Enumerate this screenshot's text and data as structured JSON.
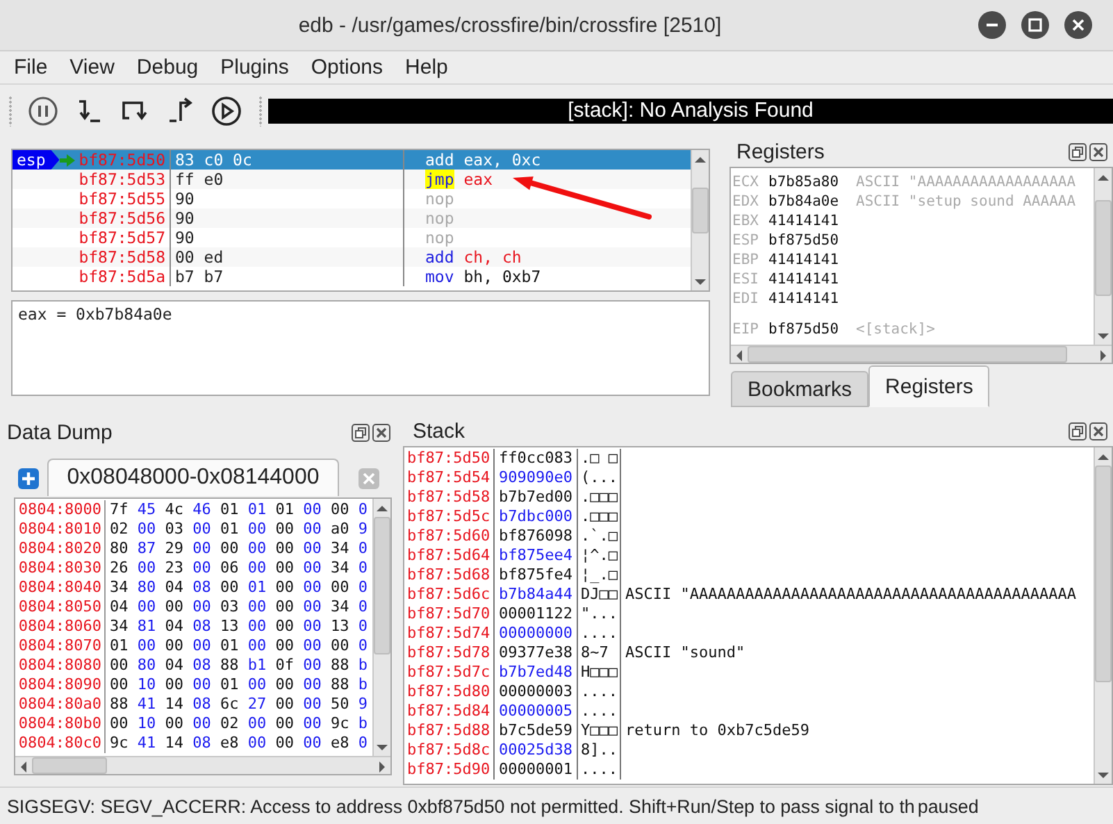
{
  "window": {
    "title": "edb - /usr/games/crossfire/bin/crossfire [2510]"
  },
  "menu": [
    "File",
    "View",
    "Debug",
    "Plugins",
    "Options",
    "Help"
  ],
  "toolbar": {
    "analysis": "[stack]: No Analysis Found"
  },
  "disassembly": {
    "rows": [
      {
        "label": "esp",
        "current": true,
        "selected": true,
        "highlighted": false,
        "address": "bf87:5d50",
        "bytes": "83 c0 0c",
        "instruction": [
          {
            "text": "add",
            "kind": "mnemonic"
          },
          {
            "text": "eax,",
            "kind": "register"
          },
          {
            "text": "0xc",
            "kind": "operand"
          }
        ]
      },
      {
        "current": false,
        "selected": false,
        "highlighted": true,
        "address": "bf87:5d53",
        "bytes": "ff e0",
        "instruction": [
          {
            "text": "jmp",
            "kind": "mnemonic"
          },
          {
            "text": "eax",
            "kind": "register"
          }
        ]
      },
      {
        "current": false,
        "selected": false,
        "highlighted": false,
        "address": "bf87:5d55",
        "bytes": "90",
        "instruction": [
          {
            "text": "nop",
            "kind": "nop"
          }
        ]
      },
      {
        "current": false,
        "selected": false,
        "highlighted": false,
        "address": "bf87:5d56",
        "bytes": "90",
        "instruction": [
          {
            "text": "nop",
            "kind": "nop"
          }
        ]
      },
      {
        "current": false,
        "selected": false,
        "highlighted": false,
        "address": "bf87:5d57",
        "bytes": "90",
        "instruction": [
          {
            "text": "nop",
            "kind": "nop"
          }
        ]
      },
      {
        "current": false,
        "selected": false,
        "highlighted": false,
        "address": "bf87:5d58",
        "bytes": "00 ed",
        "instruction": [
          {
            "text": "add",
            "kind": "mnemonic"
          },
          {
            "text": "ch,",
            "kind": "register"
          },
          {
            "text": "ch",
            "kind": "register"
          }
        ]
      },
      {
        "current": false,
        "selected": false,
        "highlighted": false,
        "address": "bf87:5d5a",
        "bytes": "b7 b7",
        "instruction": [
          {
            "text": "mov",
            "kind": "mnemonic"
          },
          {
            "text": "bh,",
            "kind": "operand"
          },
          {
            "text": "0xb7",
            "kind": "operand"
          }
        ]
      }
    ],
    "annotation": {
      "kind": "arrow"
    }
  },
  "expression": {
    "text": "eax = 0xb7b84a0e"
  },
  "registers": {
    "title": "Registers",
    "rows": [
      {
        "name": "ECX",
        "value": "b7b85a80",
        "comment": "ASCII \"AAAAAAAAAAAAAAAAAA"
      },
      {
        "name": "EDX",
        "value": "b7b84a0e",
        "comment": "ASCII \"setup sound AAAAAA"
      },
      {
        "name": "EBX",
        "value": "41414141"
      },
      {
        "name": "ESP",
        "value": "bf875d50"
      },
      {
        "name": "EBP",
        "value": "41414141"
      },
      {
        "name": "ESI",
        "value": "41414141"
      },
      {
        "name": "EDI",
        "value": "41414141"
      }
    ],
    "instruction_pointer": {
      "name": "EIP",
      "value": "bf875d50",
      "comment": "<[stack]>"
    },
    "tabs": [
      {
        "label": "Bookmarks",
        "selected": false
      },
      {
        "label": "Registers",
        "selected": true
      }
    ]
  },
  "data_dump": {
    "title": "Data Dump",
    "tab": "0x08048000-0x08144000",
    "rows": [
      {
        "address": "0804:8000",
        "bytes": [
          "7f",
          "45",
          "4c",
          "46",
          "01",
          "01",
          "01",
          "00",
          "00",
          "0"
        ]
      },
      {
        "address": "0804:8010",
        "bytes": [
          "02",
          "00",
          "03",
          "00",
          "01",
          "00",
          "00",
          "00",
          "a0",
          "9"
        ]
      },
      {
        "address": "0804:8020",
        "bytes": [
          "80",
          "87",
          "29",
          "00",
          "00",
          "00",
          "00",
          "00",
          "34",
          "0"
        ]
      },
      {
        "address": "0804:8030",
        "bytes": [
          "26",
          "00",
          "23",
          "00",
          "06",
          "00",
          "00",
          "00",
          "34",
          "0"
        ]
      },
      {
        "address": "0804:8040",
        "bytes": [
          "34",
          "80",
          "04",
          "08",
          "00",
          "01",
          "00",
          "00",
          "00",
          "0"
        ]
      },
      {
        "address": "0804:8050",
        "bytes": [
          "04",
          "00",
          "00",
          "00",
          "03",
          "00",
          "00",
          "00",
          "34",
          "0"
        ]
      },
      {
        "address": "0804:8060",
        "bytes": [
          "34",
          "81",
          "04",
          "08",
          "13",
          "00",
          "00",
          "00",
          "13",
          "0"
        ]
      },
      {
        "address": "0804:8070",
        "bytes": [
          "01",
          "00",
          "00",
          "00",
          "01",
          "00",
          "00",
          "00",
          "00",
          "0"
        ]
      },
      {
        "address": "0804:8080",
        "bytes": [
          "00",
          "80",
          "04",
          "08",
          "88",
          "b1",
          "0f",
          "00",
          "88",
          "b"
        ]
      },
      {
        "address": "0804:8090",
        "bytes": [
          "00",
          "10",
          "00",
          "00",
          "01",
          "00",
          "00",
          "00",
          "88",
          "b"
        ]
      },
      {
        "address": "0804:80a0",
        "bytes": [
          "88",
          "41",
          "14",
          "08",
          "6c",
          "27",
          "00",
          "00",
          "50",
          "9"
        ]
      },
      {
        "address": "0804:80b0",
        "bytes": [
          "00",
          "10",
          "00",
          "00",
          "02",
          "00",
          "00",
          "00",
          "9c",
          "b"
        ]
      },
      {
        "address": "0804:80c0",
        "bytes": [
          "9c",
          "41",
          "14",
          "08",
          "e8",
          "00",
          "00",
          "00",
          "e8",
          "0"
        ]
      }
    ]
  },
  "stack": {
    "title": "Stack",
    "rows": [
      {
        "address": "bf87:5d50",
        "value": "ff0cc083",
        "ascii": ".□ □"
      },
      {
        "address": "bf87:5d54",
        "value": "909090e0",
        "ascii": "(..."
      },
      {
        "address": "bf87:5d58",
        "value": "b7b7ed00",
        "ascii": ".□□□"
      },
      {
        "address": "bf87:5d5c",
        "value": "b7dbc000",
        "ascii": ".□□□"
      },
      {
        "address": "bf87:5d60",
        "value": "bf876098",
        "ascii": ".`.□"
      },
      {
        "address": "bf87:5d64",
        "value": "bf875ee4",
        "ascii": "¦^.□"
      },
      {
        "address": "bf87:5d68",
        "value": "bf875fe4",
        "ascii": "¦_.□"
      },
      {
        "address": "bf87:5d6c",
        "value": "b7b84a44",
        "ascii": "DJ□□",
        "comment": "ASCII \"AAAAAAAAAAAAAAAAAAAAAAAAAAAAAAAAAAAAAAAAAA"
      },
      {
        "address": "bf87:5d70",
        "value": "00001122",
        "ascii": "\"..."
      },
      {
        "address": "bf87:5d74",
        "value": "00000000",
        "ascii": "...."
      },
      {
        "address": "bf87:5d78",
        "value": "09377e38",
        "ascii": "8~7",
        "comment": "ASCII \"sound\""
      },
      {
        "address": "bf87:5d7c",
        "value": "b7b7ed48",
        "ascii": "H□□□"
      },
      {
        "address": "bf87:5d80",
        "value": "00000003",
        "ascii": "...."
      },
      {
        "address": "bf87:5d84",
        "value": "00000005",
        "ascii": "...."
      },
      {
        "address": "bf87:5d88",
        "value": "b7c5de59",
        "ascii": "Y□□□",
        "comment": "return to 0xb7c5de59"
      },
      {
        "address": "bf87:5d8c",
        "value": "00025d38",
        "ascii": "8].."
      },
      {
        "address": "bf87:5d90",
        "value": "00000001",
        "ascii": "...."
      }
    ]
  },
  "status_bar": {
    "message": "SIGSEGV: SEGV_ACCERR: Access to address 0xbf875d50 not permitted. Shift+Run/Step to pass signal to th",
    "state": "paused"
  }
}
